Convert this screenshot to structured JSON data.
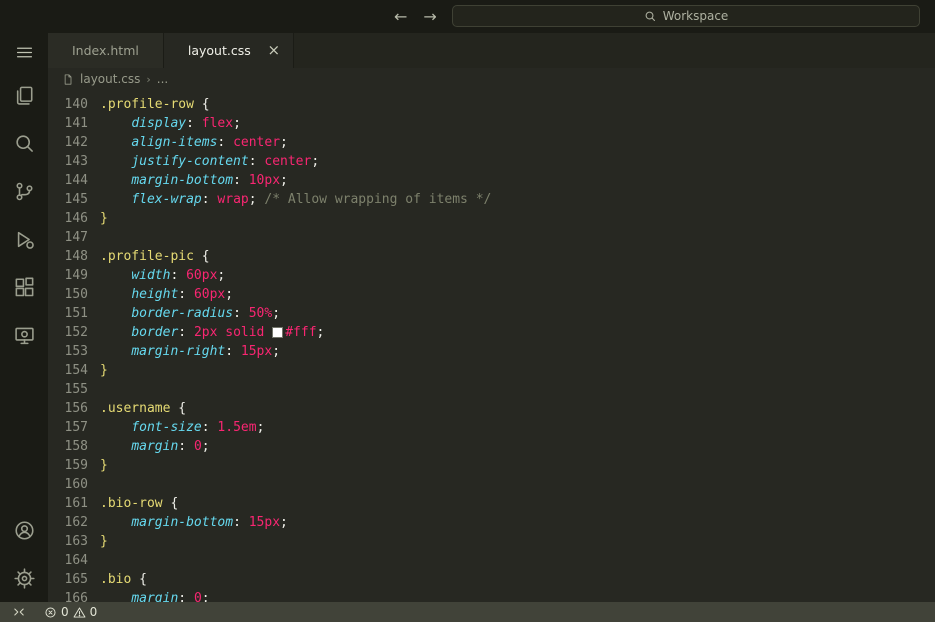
{
  "title_bar": {
    "back_glyph": "←",
    "forward_glyph": "→",
    "search_label": "Workspace"
  },
  "activity_bar": {
    "items": [
      {
        "id": "menu",
        "label": "Application Menu"
      },
      {
        "id": "explorer",
        "label": "Explorer"
      },
      {
        "id": "search",
        "label": "Search"
      },
      {
        "id": "source-control",
        "label": "Source Control"
      },
      {
        "id": "run-debug",
        "label": "Run and Debug"
      },
      {
        "id": "extensions",
        "label": "Extensions"
      },
      {
        "id": "remote-explorer",
        "label": "Remote Explorer"
      }
    ],
    "bottom_items": [
      {
        "id": "accounts",
        "label": "Accounts"
      },
      {
        "id": "settings",
        "label": "Manage"
      }
    ]
  },
  "tabs": [
    {
      "label": "Index.html",
      "active": false
    },
    {
      "label": "layout.css",
      "active": true,
      "close_glyph": "×"
    }
  ],
  "breadcrumb": {
    "file": "layout.css",
    "separator": "›",
    "more": "..."
  },
  "editor": {
    "language": "css",
    "lines": [
      {
        "n": "140",
        "t": [
          [
            "sel",
            ".profile-row"
          ],
          [
            "pun",
            " {"
          ]
        ]
      },
      {
        "n": "141",
        "t": [
          [
            "pun",
            "    "
          ],
          [
            "prop",
            "display"
          ],
          [
            "pun",
            ": "
          ],
          [
            "val",
            "flex"
          ],
          [
            "pun",
            ";"
          ]
        ]
      },
      {
        "n": "142",
        "t": [
          [
            "pun",
            "    "
          ],
          [
            "prop",
            "align-items"
          ],
          [
            "pun",
            ": "
          ],
          [
            "val",
            "center"
          ],
          [
            "pun",
            ";"
          ]
        ]
      },
      {
        "n": "143",
        "t": [
          [
            "pun",
            "    "
          ],
          [
            "prop",
            "justify-content"
          ],
          [
            "pun",
            ": "
          ],
          [
            "val",
            "center"
          ],
          [
            "pun",
            ";"
          ]
        ]
      },
      {
        "n": "144",
        "t": [
          [
            "pun",
            "    "
          ],
          [
            "prop",
            "margin-bottom"
          ],
          [
            "pun",
            ": "
          ],
          [
            "val",
            "10px"
          ],
          [
            "pun",
            ";"
          ]
        ]
      },
      {
        "n": "145",
        "t": [
          [
            "pun",
            "    "
          ],
          [
            "prop",
            "flex-wrap"
          ],
          [
            "pun",
            ": "
          ],
          [
            "val",
            "wrap"
          ],
          [
            "pun",
            "; "
          ],
          [
            "com",
            "/* Allow wrapping of items */"
          ]
        ]
      },
      {
        "n": "146",
        "t": [
          [
            "sel",
            "}"
          ]
        ]
      },
      {
        "n": "147",
        "t": []
      },
      {
        "n": "148",
        "t": [
          [
            "sel",
            ".profile-pic"
          ],
          [
            "pun",
            " {"
          ]
        ]
      },
      {
        "n": "149",
        "t": [
          [
            "pun",
            "    "
          ],
          [
            "prop",
            "width"
          ],
          [
            "pun",
            ": "
          ],
          [
            "val",
            "60px"
          ],
          [
            "pun",
            ";"
          ]
        ]
      },
      {
        "n": "150",
        "t": [
          [
            "pun",
            "    "
          ],
          [
            "prop",
            "height"
          ],
          [
            "pun",
            ": "
          ],
          [
            "val",
            "60px"
          ],
          [
            "pun",
            ";"
          ]
        ]
      },
      {
        "n": "151",
        "t": [
          [
            "pun",
            "    "
          ],
          [
            "prop",
            "border-radius"
          ],
          [
            "pun",
            ": "
          ],
          [
            "val",
            "50%"
          ],
          [
            "pun",
            ";"
          ]
        ]
      },
      {
        "n": "152",
        "t": [
          [
            "pun",
            "    "
          ],
          [
            "prop",
            "border"
          ],
          [
            "pun",
            ": "
          ],
          [
            "val",
            "2px"
          ],
          [
            "pun",
            " "
          ],
          [
            "val",
            "solid"
          ],
          [
            "pun",
            " "
          ],
          [
            "swatch",
            "#ffffff"
          ],
          [
            "val",
            "#fff"
          ],
          [
            "pun",
            ";"
          ]
        ]
      },
      {
        "n": "153",
        "t": [
          [
            "pun",
            "    "
          ],
          [
            "prop",
            "margin-right"
          ],
          [
            "pun",
            ": "
          ],
          [
            "val",
            "15px"
          ],
          [
            "pun",
            ";"
          ]
        ]
      },
      {
        "n": "154",
        "t": [
          [
            "sel",
            "}"
          ]
        ]
      },
      {
        "n": "155",
        "t": []
      },
      {
        "n": "156",
        "t": [
          [
            "sel",
            ".username"
          ],
          [
            "pun",
            " {"
          ]
        ]
      },
      {
        "n": "157",
        "t": [
          [
            "pun",
            "    "
          ],
          [
            "prop",
            "font-size"
          ],
          [
            "pun",
            ": "
          ],
          [
            "val",
            "1.5em"
          ],
          [
            "pun",
            ";"
          ]
        ]
      },
      {
        "n": "158",
        "t": [
          [
            "pun",
            "    "
          ],
          [
            "prop",
            "margin"
          ],
          [
            "pun",
            ": "
          ],
          [
            "val",
            "0"
          ],
          [
            "pun",
            ";"
          ]
        ]
      },
      {
        "n": "159",
        "t": [
          [
            "sel",
            "}"
          ]
        ]
      },
      {
        "n": "160",
        "t": []
      },
      {
        "n": "161",
        "t": [
          [
            "sel",
            ".bio-row"
          ],
          [
            "pun",
            " {"
          ]
        ]
      },
      {
        "n": "162",
        "t": [
          [
            "pun",
            "    "
          ],
          [
            "prop",
            "margin-bottom"
          ],
          [
            "pun",
            ": "
          ],
          [
            "val",
            "15px"
          ],
          [
            "pun",
            ";"
          ]
        ]
      },
      {
        "n": "163",
        "t": [
          [
            "sel",
            "}"
          ]
        ]
      },
      {
        "n": "164",
        "t": []
      },
      {
        "n": "165",
        "t": [
          [
            "sel",
            ".bio"
          ],
          [
            "pun",
            " {"
          ]
        ]
      },
      {
        "n": "166",
        "t": [
          [
            "pun",
            "    "
          ],
          [
            "prop",
            "margin"
          ],
          [
            "pun",
            ": "
          ],
          [
            "val",
            "0"
          ],
          [
            "pun",
            ";"
          ]
        ]
      }
    ]
  },
  "status_bar": {
    "errors": "0",
    "warnings": "0"
  },
  "colors": {
    "titlebar_bg": "#1a1b15",
    "activitybar_bg": "#1a1b15",
    "tabbar_bg": "#24251e",
    "tab_inactive_bg": "#2b2c25",
    "tab_active_bg": "#272822",
    "editor_bg": "#272822",
    "statusbar_bg": "#414339",
    "token_selector": "#e6db74",
    "token_property": "#66d9ef",
    "token_value": "#f92672",
    "token_comment": "#7d816c",
    "token_punctuation": "#f0f0ea",
    "line_number": "#8f9185"
  }
}
